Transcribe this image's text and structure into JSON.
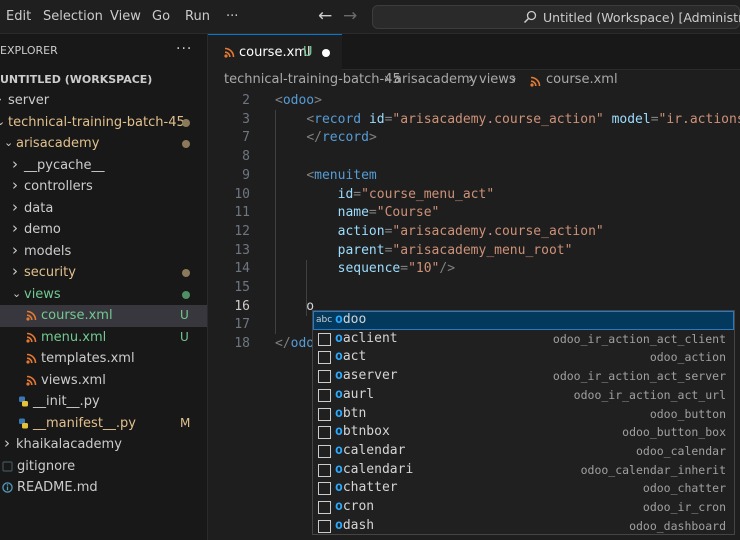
{
  "menubar": {
    "items": [
      "Edit",
      "Selection",
      "View",
      "Go",
      "Run"
    ],
    "more": "···"
  },
  "search": {
    "text": "Untitled (Workspace) [Administrator]"
  },
  "sidebar": {
    "title": "EXPLORER",
    "more": "···",
    "workspace": "UNTITLED (WORKSPACE)",
    "tree": [
      {
        "label": "server",
        "chev": "›",
        "color": "#cccccc"
      },
      {
        "label": "technical-training-batch-45",
        "chev": "⌄",
        "color": "#e2c08d",
        "dot": "#8a7a5a"
      },
      {
        "label": "arisacademy",
        "chev": "⌄",
        "color": "#e2c08d",
        "dot": "#8a7a5a"
      },
      {
        "label": "__pycache__",
        "chev": "›",
        "color": "#cccccc"
      },
      {
        "label": "controllers",
        "chev": "›",
        "color": "#cccccc"
      },
      {
        "label": "data",
        "chev": "›",
        "color": "#cccccc"
      },
      {
        "label": "demo",
        "chev": "›",
        "color": "#cccccc"
      },
      {
        "label": "models",
        "chev": "›",
        "color": "#cccccc"
      },
      {
        "label": "security",
        "chev": "›",
        "color": "#e2c08d",
        "dot": "#8a7a5a"
      },
      {
        "label": "views",
        "chev": "⌄",
        "color": "#73c991",
        "dot": "#4e8f63"
      },
      {
        "label": "course.xml",
        "icon": "rss",
        "color": "#73c991",
        "badge": "U",
        "selected": true
      },
      {
        "label": "menu.xml",
        "icon": "rss",
        "color": "#73c991",
        "badge": "U"
      },
      {
        "label": "templates.xml",
        "icon": "rss",
        "color": "#cccccc"
      },
      {
        "label": "views.xml",
        "icon": "rss",
        "color": "#cccccc"
      },
      {
        "label": "__init__.py",
        "icon": "py",
        "color": "#cccccc"
      },
      {
        "label": "__manifest__.py",
        "icon": "py",
        "color": "#e2c08d",
        "badge": "M"
      },
      {
        "label": "khaikalacademy",
        "chev": "›",
        "color": "#cccccc"
      },
      {
        "label": "gitignore",
        "icon": "git",
        "color": "#cccccc"
      },
      {
        "label": "README.md",
        "icon": "info",
        "color": "#cccccc"
      }
    ]
  },
  "tab": {
    "label": "course.xml",
    "flag": "U"
  },
  "breadcrumb": [
    "technical-training-batch-45",
    "arisacademy",
    "views",
    "course.xml"
  ],
  "editor": {
    "lines": [
      {
        "n": "2",
        "tokens": [
          [
            "t",
            "<odoo>"
          ]
        ]
      },
      {
        "n": "3",
        "tokens": [
          [
            "t",
            "    <record "
          ],
          [
            "a",
            "id"
          ],
          [
            "p",
            "="
          ],
          [
            "s",
            "\"arisacademy.course_action\""
          ],
          [
            "p",
            " "
          ],
          [
            "a",
            "model"
          ],
          [
            "p",
            "="
          ],
          [
            "s",
            "\"ir.actions.act_window\""
          ]
        ]
      },
      {
        "n": "7",
        "tokens": [
          [
            "t",
            "    </record>"
          ]
        ]
      },
      {
        "n": "8",
        "tokens": []
      },
      {
        "n": "9",
        "tokens": [
          [
            "t",
            "    <menuitem"
          ]
        ]
      },
      {
        "n": "10",
        "tokens": [
          [
            "a",
            "        id"
          ],
          [
            "p",
            "="
          ],
          [
            "s",
            "\"course_menu_act\""
          ]
        ]
      },
      {
        "n": "11",
        "tokens": [
          [
            "a",
            "        name"
          ],
          [
            "p",
            "="
          ],
          [
            "s",
            "\"Course\""
          ]
        ]
      },
      {
        "n": "12",
        "tokens": [
          [
            "a",
            "        action"
          ],
          [
            "p",
            "="
          ],
          [
            "s",
            "\"arisacademy.course_action\""
          ]
        ]
      },
      {
        "n": "13",
        "tokens": [
          [
            "a",
            "        parent"
          ],
          [
            "p",
            "="
          ],
          [
            "s",
            "\"arisacademy_menu_root\""
          ]
        ]
      },
      {
        "n": "14",
        "tokens": [
          [
            "a",
            "        sequence"
          ],
          [
            "p",
            "="
          ],
          [
            "s",
            "\"10\""
          ],
          [
            "t",
            "/>"
          ]
        ]
      },
      {
        "n": "15",
        "tokens": []
      },
      {
        "n": "16",
        "tokens": [
          [
            "x",
            "    o"
          ]
        ],
        "active": true
      },
      {
        "n": "17",
        "tokens": []
      },
      {
        "n": "18",
        "tokens": [
          [
            "t",
            "</odoo>"
          ]
        ]
      }
    ]
  },
  "suggest": [
    {
      "label": "odoo",
      "detail": "",
      "kind": "abc",
      "focused": true
    },
    {
      "label": "oaclient",
      "detail": "odoo_ir_action_act_client",
      "kind": "snippet"
    },
    {
      "label": "oact",
      "detail": "odoo_action",
      "kind": "snippet"
    },
    {
      "label": "oaserver",
      "detail": "odoo_ir_action_act_server",
      "kind": "snippet"
    },
    {
      "label": "oaurl",
      "detail": "odoo_ir_action_act_url",
      "kind": "snippet"
    },
    {
      "label": "obtn",
      "detail": "odoo_button",
      "kind": "snippet"
    },
    {
      "label": "obtnbox",
      "detail": "odoo_button_box",
      "kind": "snippet"
    },
    {
      "label": "ocalendar",
      "detail": "odoo_calendar",
      "kind": "snippet"
    },
    {
      "label": "ocalendari",
      "detail": "odoo_calendar_inherit",
      "kind": "snippet"
    },
    {
      "label": "ochatter",
      "detail": "odoo_chatter",
      "kind": "snippet"
    },
    {
      "label": "ocron",
      "detail": "odoo_ir_cron",
      "kind": "snippet"
    },
    {
      "label": "odash",
      "detail": "odoo_dashboard",
      "kind": "snippet"
    }
  ]
}
